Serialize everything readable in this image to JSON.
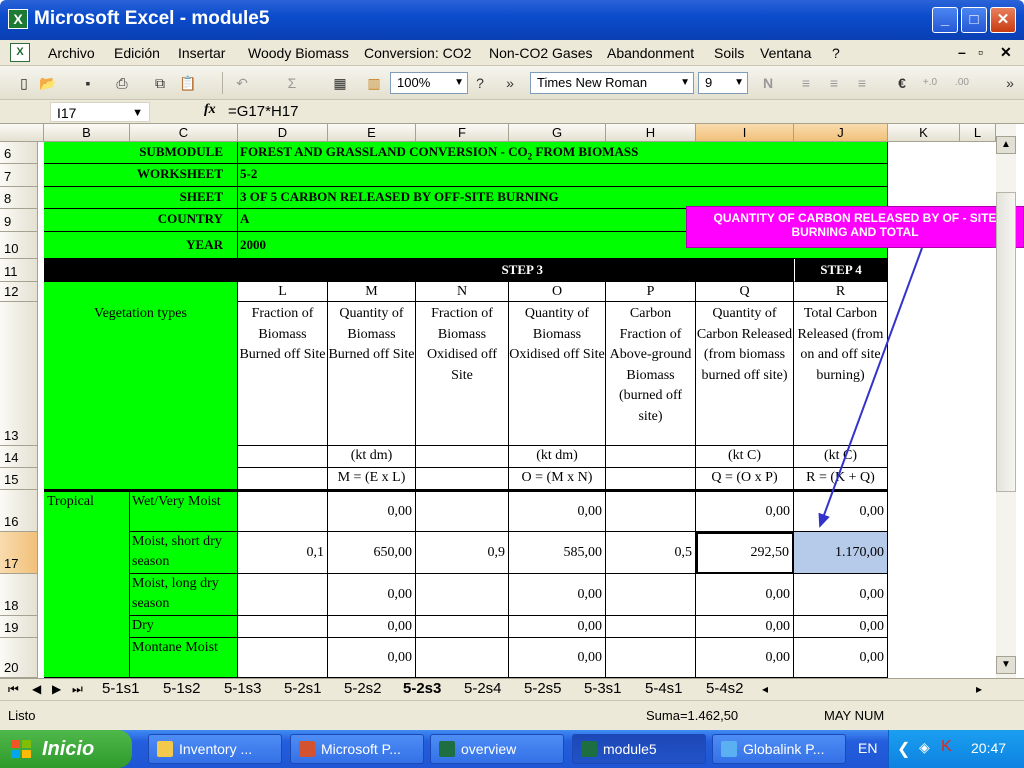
{
  "window": {
    "title": "Microsoft Excel - module5"
  },
  "menu": [
    "Archivo",
    "Edición",
    "Insertar",
    "Woody Biomass",
    "Conversion: CO2",
    "Non-CO2 Gases",
    "Abandonment",
    "Soils",
    "Ventana",
    "?"
  ],
  "toolbar": {
    "zoom": "100%",
    "font": "Times New Roman",
    "size": "9"
  },
  "formula": {
    "cell": "I17",
    "fx": "fx",
    "content": "=G17*H17"
  },
  "columns": [
    "",
    "B",
    "C",
    "D",
    "E",
    "F",
    "G",
    "H",
    "I",
    "J",
    "K",
    "L"
  ],
  "rows": [
    "6",
    "7",
    "8",
    "9",
    "10",
    "11",
    "12",
    "13",
    "14",
    "15",
    "16",
    "17",
    "18",
    "19",
    "20"
  ],
  "header": {
    "submodule_label": "SUBMODULE",
    "submodule_value": "FOREST AND GRASSLAND CONVERSION - CO",
    "submodule_sub": "2",
    "submodule_tail": " FROM BIOMASS",
    "worksheet_label": "WORKSHEET",
    "worksheet_value": "5-2",
    "sheet_label": "SHEET",
    "sheet_value": "3 OF 5   CARBON RELEASED BY OFF-SITE BURNING",
    "country_label": "COUNTRY",
    "country_value": "A",
    "year_label": "YEAR",
    "year_value": "2000",
    "step3": "STEP 3",
    "step4": "STEP 4"
  },
  "vegetation_label": "Vegetation types",
  "table_cols": [
    {
      "letter": "L",
      "title": "Fraction of Biomass Burned off Site",
      "unit": "",
      "formula": ""
    },
    {
      "letter": "M",
      "title": "Quantity of Biomass Burned off Site",
      "unit": "(kt dm)",
      "formula": "M = (E x L)"
    },
    {
      "letter": "N",
      "title": "Fraction of Biomass Oxidised off Site",
      "unit": "",
      "formula": ""
    },
    {
      "letter": "O",
      "title": "Quantity of Biomass Oxidised off Site",
      "unit": "(kt dm)",
      "formula": "O = (M x N)"
    },
    {
      "letter": "P",
      "title": "Carbon Fraction of Above-ground Biomass (burned off site)",
      "unit": "",
      "formula": ""
    },
    {
      "letter": "Q",
      "title": "Quantity of Carbon Released (from biomass burned off site)",
      "unit": "(kt C)",
      "formula": "Q = (O x P)"
    },
    {
      "letter": "R",
      "title": "Total Carbon Released (from on and off site burning)",
      "unit": "(kt C)",
      "formula": "R = (K + Q)"
    }
  ],
  "data_rows": [
    {
      "group": "Tropical",
      "type": "Wet/Very Moist",
      "vals": [
        "",
        "0,00",
        "",
        "0,00",
        "",
        "0,00",
        "0,00"
      ]
    },
    {
      "group": "",
      "type": "Moist, short dry season",
      "vals": [
        "0,1",
        "650,00",
        "0,9",
        "585,00",
        "0,5",
        "292,50",
        "1.170,00"
      ]
    },
    {
      "group": "",
      "type": "Moist, long dry season",
      "vals": [
        "",
        "0,00",
        "",
        "0,00",
        "",
        "0,00",
        "0,00"
      ]
    },
    {
      "group": "",
      "type": "Dry",
      "vals": [
        "",
        "0,00",
        "",
        "0,00",
        "",
        "0,00",
        "0,00"
      ]
    },
    {
      "group": "",
      "type": "Montane Moist",
      "vals": [
        "",
        "0,00",
        "",
        "0,00",
        "",
        "0,00",
        "0,00"
      ]
    }
  ],
  "callout": "QUANTITY OF CARBON RELEASED BY OF - SITE BURNING AND TOTAL",
  "sheet_tabs": [
    "5-1s1",
    "5-1s2",
    "5-1s3",
    "5-2s1",
    "5-2s2",
    "5-2s3",
    "5-2s4",
    "5-2s5",
    "5-3s1",
    "5-4s1",
    "5-4s2"
  ],
  "active_tab": "5-2s3",
  "status": {
    "left": "Listo",
    "sum": "Suma=1.462,50",
    "mode": "MAY NUM"
  },
  "taskbar": {
    "start": "Inicio",
    "tasks": [
      "Inventory ...",
      "Microsoft P...",
      "overview",
      "module5",
      "Globalink P..."
    ],
    "lang": "EN",
    "clock": "20:47"
  }
}
